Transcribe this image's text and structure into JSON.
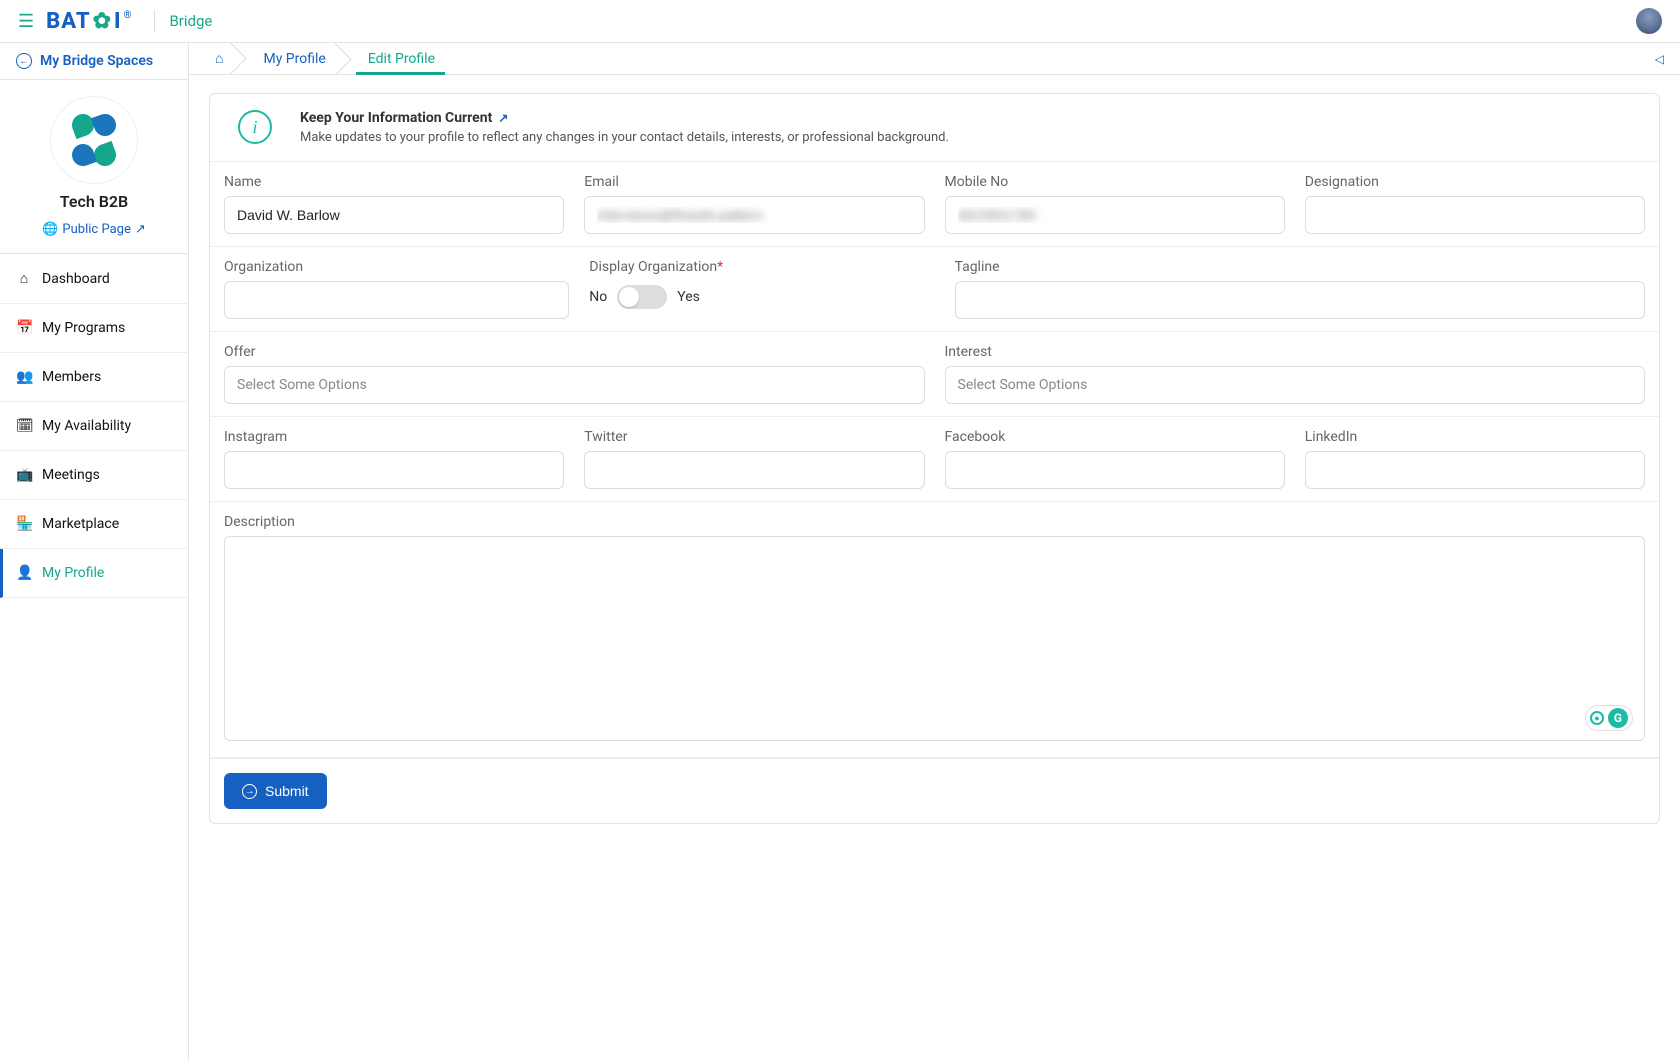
{
  "header": {
    "logo_text": "BATOI",
    "app_name": "Bridge"
  },
  "sidebar": {
    "back_label": "My Bridge Spaces",
    "space_name": "Tech B2B",
    "public_page_label": "Public Page",
    "nav": [
      {
        "label": "Dashboard",
        "icon": "home"
      },
      {
        "label": "My Programs",
        "icon": "calendar"
      },
      {
        "label": "Members",
        "icon": "users"
      },
      {
        "label": "My Availability",
        "icon": "clock"
      },
      {
        "label": "Meetings",
        "icon": "video"
      },
      {
        "label": "Marketplace",
        "icon": "store"
      },
      {
        "label": "My Profile",
        "icon": "user",
        "active": true
      }
    ]
  },
  "breadcrumbs": {
    "items": [
      {
        "label": "",
        "is_home": true
      },
      {
        "label": "My Profile"
      },
      {
        "label": "Edit Profile",
        "active": true
      }
    ]
  },
  "info": {
    "title": "Keep Your Information Current",
    "subtitle": "Make updates to your profile to reflect any changes in your contact details, interests, or professional background."
  },
  "form": {
    "name": {
      "label": "Name",
      "value": "David W. Barlow"
    },
    "email": {
      "label": "Email",
      "value": "interviews@finweb-pattern"
    },
    "mobile": {
      "label": "Mobile No",
      "value": "4615901780"
    },
    "designation": {
      "label": "Designation",
      "value": ""
    },
    "organization": {
      "label": "Organization",
      "value": ""
    },
    "display_org": {
      "label": "Display Organization",
      "no": "No",
      "yes": "Yes",
      "value": "No"
    },
    "tagline": {
      "label": "Tagline",
      "value": ""
    },
    "offer": {
      "label": "Offer",
      "placeholder": "Select Some Options"
    },
    "interest": {
      "label": "Interest",
      "placeholder": "Select Some Options"
    },
    "instagram": {
      "label": "Instagram",
      "value": ""
    },
    "twitter": {
      "label": "Twitter",
      "value": ""
    },
    "facebook": {
      "label": "Facebook",
      "value": ""
    },
    "linkedin": {
      "label": "LinkedIn",
      "value": ""
    },
    "description": {
      "label": "Description",
      "value": ""
    },
    "submit_label": "Submit"
  }
}
